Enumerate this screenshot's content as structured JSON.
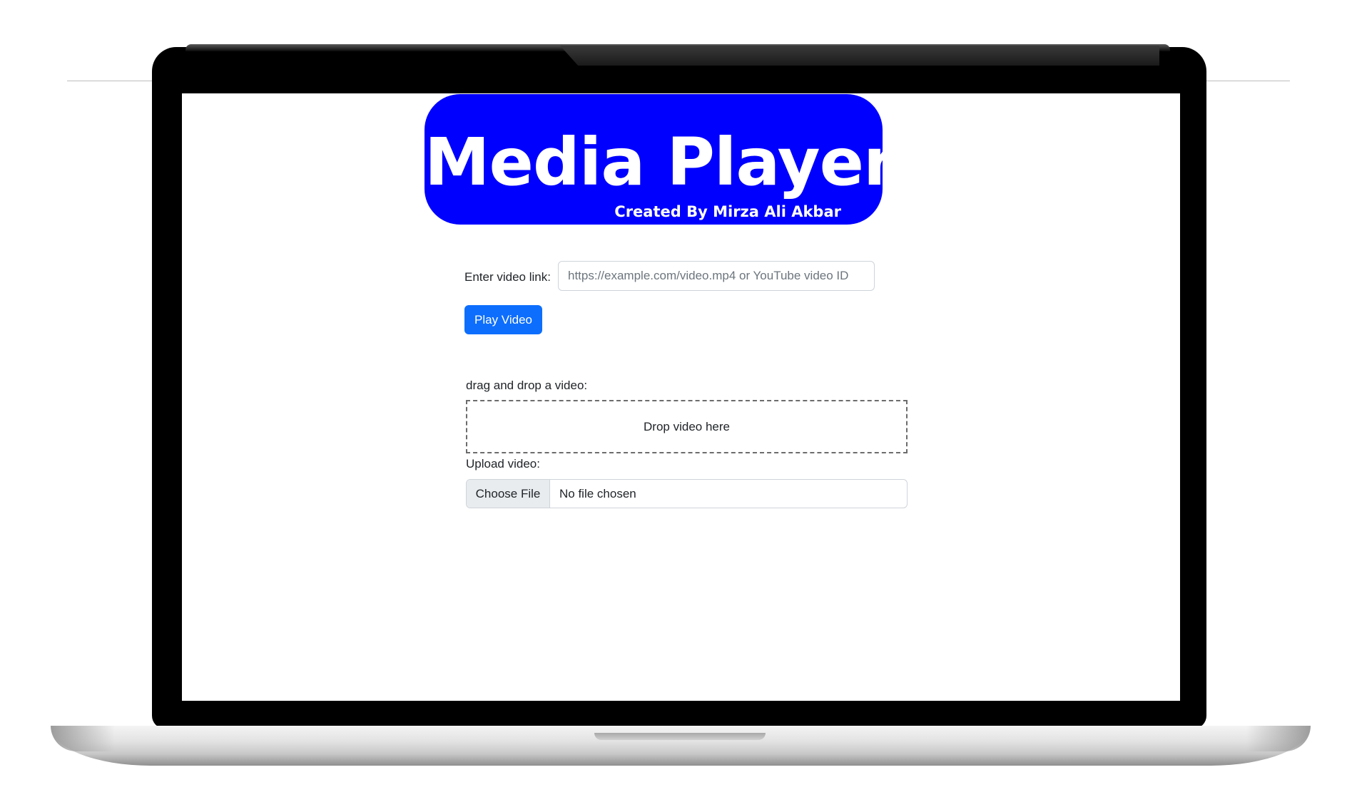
{
  "header": {
    "title": "Media Player",
    "subtitle": "Created By Mirza Ali Akbar",
    "background_color": "#0000ff"
  },
  "link_form": {
    "label": "Enter video link:",
    "input_value": "",
    "input_placeholder": "https://example.com/video.mp4 or YouTube video ID",
    "play_button_label": "Play Video",
    "play_button_color": "#0d6efd"
  },
  "drag_drop": {
    "label": "drag and drop a video:",
    "zone_text": "Drop video here"
  },
  "upload": {
    "label": "Upload video:",
    "choose_button_label": "Choose File",
    "status_text": "No file chosen"
  },
  "device": {
    "frame": "laptop",
    "bezel_color": "#000000"
  }
}
